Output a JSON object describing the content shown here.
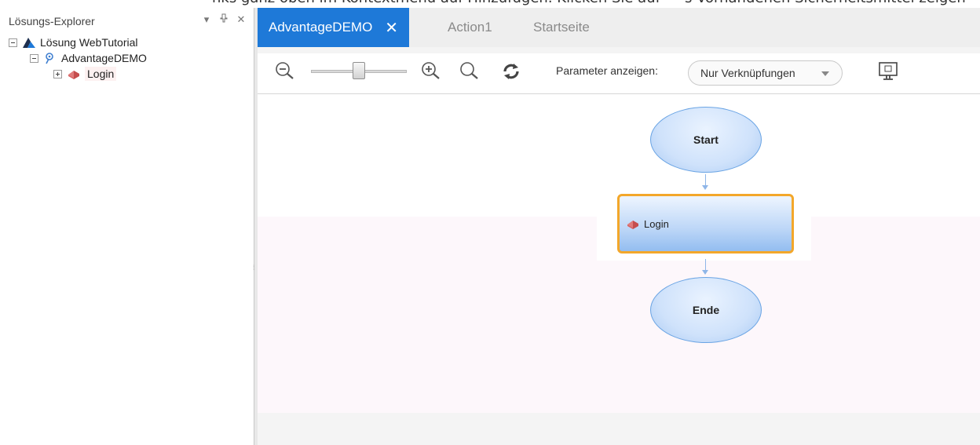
{
  "top_strip": {
    "left_text": "nks ganz oben im Kontextmenü auf Hinzufügen. Klicken Sie auf",
    "right_text": "s Vorhandenen Sicherheitsmittel zeigen"
  },
  "solution_explorer": {
    "title": "Lösungs-Explorer",
    "controls": [
      "dropdown-icon",
      "pin-icon",
      "close-icon"
    ],
    "tree": [
      {
        "label": "Lösung WebTutorial",
        "icon": "solution-icon",
        "expanded": true
      },
      {
        "label": "AdvantageDEMO",
        "icon": "test-icon",
        "expanded": true
      },
      {
        "label": "Login",
        "icon": "action-icon",
        "expanded": false,
        "selected": true
      }
    ]
  },
  "tabs": [
    {
      "label": "AdvantageDEMO",
      "active": true
    },
    {
      "label": "Action1",
      "active": false
    },
    {
      "label": "Startseite",
      "active": false
    }
  ],
  "toolbar": {
    "zoom_level": 0.47,
    "param_label": "Parameter anzeigen:",
    "param_value": "Nur Verknüpfungen"
  },
  "flow": {
    "start": "Start",
    "action": "Login",
    "end": "Ende"
  },
  "colors": {
    "tab_active": "#1e79d8",
    "node_border": "#f3a72a",
    "node_fill": "#bcd6f7"
  }
}
